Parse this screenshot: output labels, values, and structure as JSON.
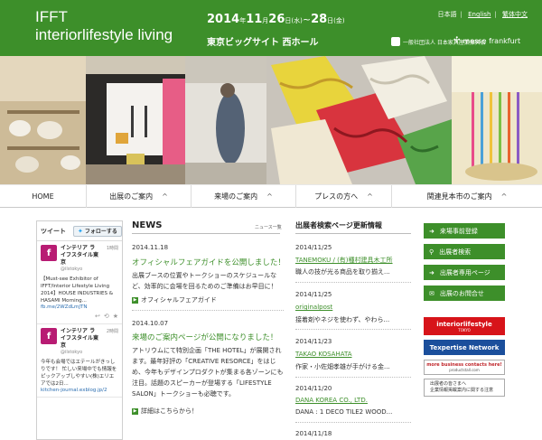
{
  "header": {
    "logo_line1": "IFFT",
    "logo_line2": "interiorlifestyle living",
    "dates": {
      "year": "2014",
      "m1": "11",
      "d1": "26",
      "w1": "(水)",
      "sep": "~",
      "d2": "28",
      "w2": "(金)"
    },
    "venue": "東京ビッグサイト 西ホール",
    "languages": [
      "日本語",
      "English",
      "繁体中文"
    ],
    "sponsor_1": "一般社団法人 日本家具産業振興会",
    "sponsor_2": "messe frankfurt"
  },
  "nav": {
    "items": [
      {
        "label": "HOME",
        "caret": ""
      },
      {
        "label": "出展のご案内",
        "caret": "^"
      },
      {
        "label": "来場のご案内",
        "caret": "^"
      },
      {
        "label": "プレスの方へ",
        "caret": "^"
      },
      {
        "label": "関連見本市のご案内",
        "caret": "^"
      }
    ]
  },
  "twitter": {
    "heading": "ツイート",
    "follow_label": "フォローする",
    "tweets": [
      {
        "name": "インテリア ライフスタイル東京",
        "handle": "@ilstokyo",
        "time": "1時間",
        "text": "【Must-see Exhibitor of IFFT/Interior Lifestyle Living 2014】HOUSE INDUSTRIES & HASAMI Morning...",
        "link": "fb.me/2WZdLmJTN"
      },
      {
        "name": "インテリア ライフスタイル東京",
        "handle": "@ilstokyo",
        "time": "2時間",
        "text": "今年も会場ではエテールがきっしりです！ 忙しい来場中でも情報をピックアップしやすい(株)エリエアでは2日...",
        "link": "kitchen-journal.exblog.jp/2"
      }
    ]
  },
  "news": {
    "title": "NEWS",
    "list_link": "ニュース一覧",
    "items": [
      {
        "date": "2014.11.18",
        "headline": "オフィシャルフェアガイドを公開しました！",
        "body": "出展ブースの位置やトークショーのスケジュールなど、効率的に会場を回るためのご準備はお早目に！",
        "more": "オフィシャルフェアガイド"
      },
      {
        "date": "2014.10.07",
        "headline": "来場のご案内ページが公開になりました！",
        "body": "アトリウムにて特別企画「THE HOTEL」が展開されます。最年好評の「CREATIVE RESORCE」をはじめ、今年もデザインプロダクトが集まる各ゾーンにも注目。話題のスピーカーが登場する「LIFESTYLE SALON」トークショーも必聴です。",
        "more": "詳細はこちらから！"
      }
    ]
  },
  "exhibitors": {
    "title": "出展者検索ページ更新情報",
    "items": [
      {
        "date": "2014/11/25",
        "company": "TANEMOKU / (有)種村建具木工所",
        "desc": "職人の技が光る商品を取り揃え..."
      },
      {
        "date": "2014/11/25",
        "company": "originalpost",
        "desc": "接着剤やネジを使わず、やわら..."
      },
      {
        "date": "2014/11/23",
        "company": "TAKAO KOSAHATA",
        "desc": "作家・小佐畑孝雄が手がける金..."
      },
      {
        "date": "2014/11/20",
        "company": "DANA KOREA CO., LTD.",
        "desc": "DANA : 1 DECO TILE2 WOOD..."
      },
      {
        "date": "2014/11/18",
        "company": "",
        "desc": ""
      }
    ]
  },
  "sidebar": {
    "buttons": [
      {
        "label": "来場事前登録",
        "icon": "arrow-right-icon",
        "glyph": "➜"
      },
      {
        "label": "出展者検索",
        "icon": "search-icon",
        "glyph": "⚲"
      },
      {
        "label": "出展者専用ページ",
        "icon": "arrow-right-icon",
        "glyph": "➜"
      },
      {
        "label": "出展のお問合せ",
        "icon": "mail-icon",
        "glyph": "✉"
      }
    ],
    "banner_ifl": {
      "line1": "interiorlifestyle",
      "line2": "TOKYO"
    },
    "banner_texpertise": "Texpertise Network",
    "banner_more": {
      "line1": "more business contacts here!",
      "line2": "productstall.com"
    },
    "guide": {
      "line1": "出展者の皆さまへ",
      "line2": "企業情報掲載案内に関する注意"
    }
  },
  "colors": {
    "brand_green": "#3d8f2a",
    "ifl_red": "#d7141a",
    "texpertise_blue": "#1b4f9c",
    "twitter_pink": "#b81c73"
  }
}
